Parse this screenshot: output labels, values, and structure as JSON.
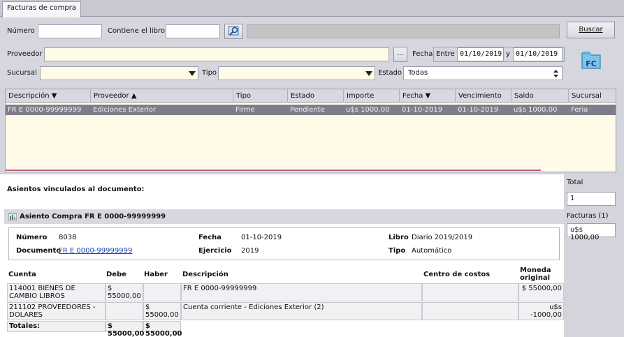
{
  "tab": {
    "label": "Facturas de compra"
  },
  "filters": {
    "numero_label": "Número",
    "contiene_label": "Contiene el libro",
    "proveedor_label": "Proveedor",
    "sucursal_label": "Sucursal",
    "tipo_label": "Tipo",
    "estado_label": "Estado",
    "estado_value": "Todas",
    "ellipsis": "...",
    "fecha_label": "Fecha",
    "entre_label": "Entre",
    "fecha_desde": "01/10/2019",
    "y_label": "y",
    "fecha_hasta": "01/10/2019",
    "buscar_label": "Buscar",
    "fc_badge": "FC"
  },
  "grid": {
    "headers": [
      "Descripción ▼",
      "Proveedor ▲",
      "Tipo",
      "Estado",
      "Importe",
      "Fecha ▼",
      "Vencimiento",
      "Saldo",
      "Sucursal"
    ],
    "rows": [
      [
        "FR E 0000-99999999",
        "Ediciones Exterior",
        "Firme",
        "Pendiente",
        "u$s 1000,00",
        "01-10-2019",
        "01-10-2019",
        "u$s 1000,00",
        "Feria"
      ]
    ]
  },
  "detail": {
    "title": "Asientos vinculados al documento:",
    "asiento_title": "Asiento Compra FR E 0000-99999999",
    "numero_label": "Número",
    "numero_value": "8038",
    "documento_label": "Documento",
    "documento_value": "FR E 0000-99999999",
    "fecha_label": "Fecha",
    "fecha_value": "01-10-2019",
    "ejercicio_label": "Ejercicio",
    "ejercicio_value": "2019",
    "libro_label": "Libro",
    "libro_value": "Diario 2019/2019",
    "tipo_label": "Tipo",
    "tipo_value": "Automático"
  },
  "entries": {
    "headers": {
      "cuenta": "Cuenta",
      "debe": "Debe",
      "haber": "Haber",
      "descripcion": "Descripción",
      "centro": "Centro de costos",
      "moneda": "Moneda original"
    },
    "rows": [
      {
        "cuenta": "114001 BIENES DE CAMBIO LIBROS",
        "debe": "$ 55000,00",
        "haber": "",
        "descripcion": "FR E 0000-99999999",
        "centro": "",
        "moneda": "$ 55000,00"
      },
      {
        "cuenta": "211102 PROVEEDORES - DOLARES",
        "debe": "",
        "haber": "$ 55000,00",
        "descripcion": "Cuenta corriente - Ediciones Exterior (2)",
        "centro": "",
        "moneda": "u$s -1000,00"
      }
    ],
    "totals": {
      "label": "Totales:",
      "debe": "$ 55000,00",
      "haber": "$ 55000,00"
    }
  },
  "sidebar": {
    "total_label": "Total",
    "total_value": "1",
    "facturas_label": "Facturas (1)",
    "facturas_value": "u$s 1000,00"
  }
}
